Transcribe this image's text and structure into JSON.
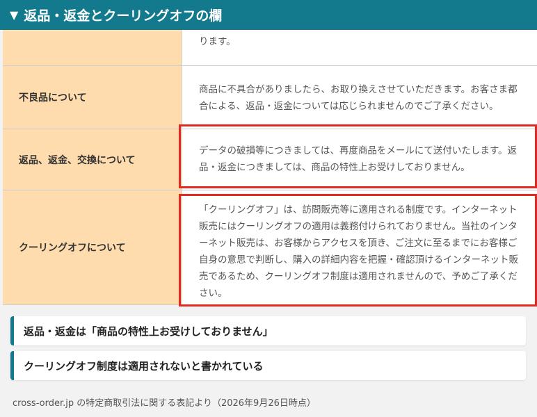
{
  "header": {
    "icon": "triangle-down-icon",
    "title": "返品・返金とクーリングオフの欄",
    "color": "#127a8c"
  },
  "table": {
    "rows": [
      {
        "label": "",
        "value": "ります。"
      },
      {
        "label": "不良品について",
        "value": "商品に不具合がありましたら、お取り換えさせていただきます。お客さま都合による、返品・返金については応じられませんのでご了承ください。"
      },
      {
        "label": "返品、返金、交換について",
        "value": "データの破損等につきましては、再度商品をメールにて送付いたします。返品・返金につきましては、商品の特性上お受けしておりません。"
      },
      {
        "label": "クーリングオフについて",
        "value": "「クーリングオフ」は、訪問販売等に適用される制度です。インターネット販売にはクーリングオフの適用は義務付けられておりません。当社のインターネット販売は、お客様からアクセスを頂き、ご注文に至るまでにお客様ご自身の意思で判断し、購入の詳細内容を把握・確認頂けるインターネット販売であるため、クーリングオフ制度は適用されませんので、予めご了承ください。"
      }
    ],
    "label_bg": "#fedcae",
    "highlight_color": "#e02a22"
  },
  "notes": [
    "返品・返金は「商品の特性上お受けしておりません」",
    "クーリングオフ制度は適用されないと書かれている"
  ],
  "source": "cross-order.jp の特定商取引法に関する表記より（2026年9月26日時点）"
}
